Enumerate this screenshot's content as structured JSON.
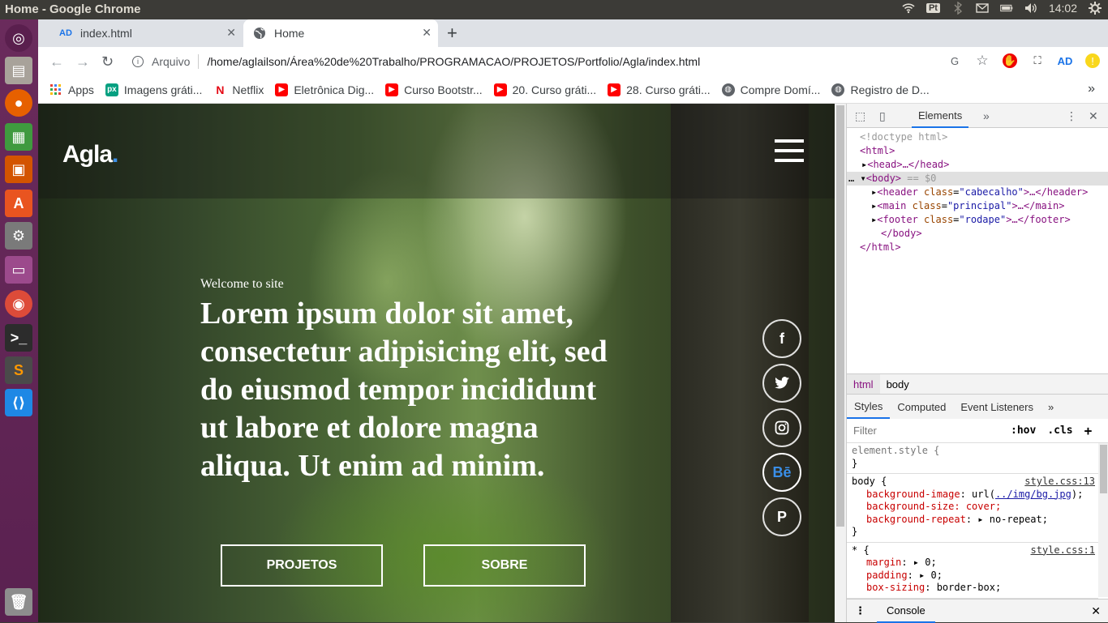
{
  "window": {
    "title": "Home - Google Chrome"
  },
  "tray": {
    "keyboard": "Pt",
    "time": "14:02"
  },
  "tabs": [
    {
      "label": "index.html",
      "favicon": "AD"
    },
    {
      "label": "Home"
    }
  ],
  "omnibox": {
    "security_label": "Arquivo",
    "url": "/home/aglailson/Área%20de%20Trabalho/PROGRAMACAO/PROJETOS/Portfolio/Agla/index.html"
  },
  "bookmarks": [
    {
      "label": "Apps",
      "icon": "apps-grid-icon"
    },
    {
      "label": "Imagens gráti...",
      "icon": "px-icon"
    },
    {
      "label": "Netflix",
      "icon": "netflix-icon"
    },
    {
      "label": "Eletrônica Dig...",
      "icon": "youtube-icon"
    },
    {
      "label": "Curso Bootstr...",
      "icon": "youtube-icon"
    },
    {
      "label": "20. Curso gráti...",
      "icon": "youtube-icon"
    },
    {
      "label": "28. Curso gráti...",
      "icon": "youtube-icon"
    },
    {
      "label": "Compre Domí...",
      "icon": "globe-icon"
    },
    {
      "label": "Registro de D...",
      "icon": "globe-icon"
    }
  ],
  "site": {
    "logo": "Agla",
    "logo_dot": ".",
    "welcome": "Welcome to site",
    "headline": "Lorem ipsum dolor sit amet, consectetur adipisicing elit, sed do eiusmod tempor incididunt ut labore et dolore magna aliqua. Ut enim ad minim.",
    "buttons": {
      "projects": "PROJETOS",
      "about": "SOBRE"
    },
    "social": [
      "f",
      "Bē",
      "P"
    ]
  },
  "devtools": {
    "panel_tab": "Elements",
    "dom": {
      "doctype": "<!doctype html>",
      "html_open": "<html>",
      "head": "<head>…</head>",
      "body_open": "<body>",
      "body_marker": "== $0",
      "header_tag": "<header",
      "header_attr": "class",
      "header_val": "\"cabecalho\"",
      "header_close": ">…</header>",
      "main_tag": "<main",
      "main_attr": "class",
      "main_val": "\"principal\"",
      "main_close": ">…</main>",
      "footer_tag": "<footer",
      "footer_attr": "class",
      "footer_val": "\"rodape\"",
      "footer_close": ">…</footer>",
      "body_close": "</body>",
      "html_close": "</html>"
    },
    "breadcrumbs": [
      "html",
      "body"
    ],
    "style_tabs": [
      "Styles",
      "Computed",
      "Event Listeners"
    ],
    "filter_placeholder": "Filter",
    "hov": ":hov",
    "cls": ".cls",
    "element_style": "element.style {",
    "body_rule": {
      "selector": "body {",
      "source": "style.css:13",
      "bg_image_name": "background-image",
      "bg_image_pre": "url(",
      "bg_image_link": "../img/bg.jpg",
      "bg_image_post": ");",
      "bg_size": "background-size: cover;",
      "bg_repeat_name": "background-repeat",
      "bg_repeat_val": "no-repeat;"
    },
    "star_rule": {
      "selector": "* {",
      "source": "style.css:1",
      "margin_name": "margin",
      "margin_val": "0;",
      "padding_name": "padding",
      "padding_val": "0;",
      "box_name": "box-sizing",
      "box_val": "border-box;"
    },
    "drawer_tab": "Console"
  },
  "colors": {
    "accent_blue": "#1a73e8",
    "logo_dot": "#3a8fe8",
    "launcher": "#6a2b5c"
  }
}
